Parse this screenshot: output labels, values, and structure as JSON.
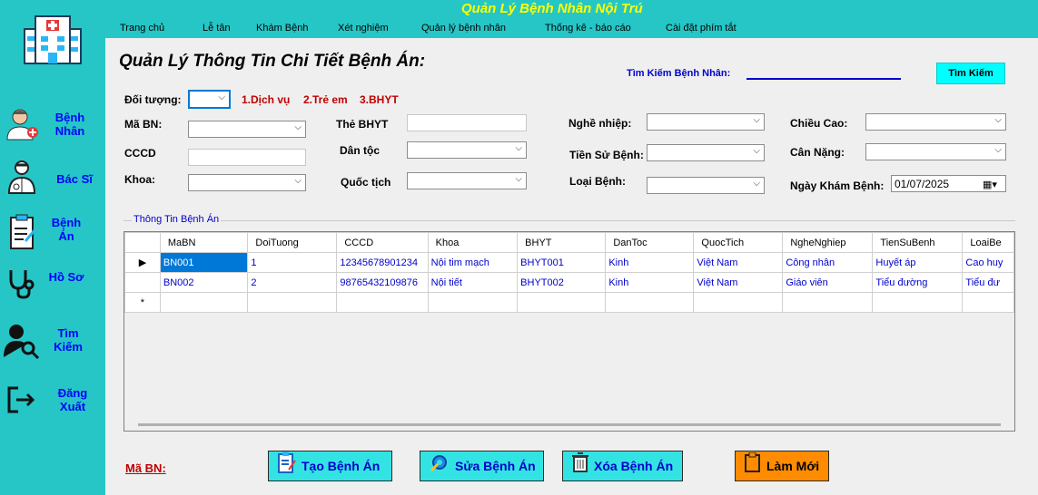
{
  "app": {
    "title": "Quản Lý Bệnh Nhân Nội Trú"
  },
  "menu": [
    "Trang chủ",
    "Lễ tân",
    "Khám Bệnh",
    "Xét nghiệm",
    "Quản lý bệnh nhân",
    "Thống kê - báo cáo",
    "Cài đặt phím tắt"
  ],
  "sidebar": {
    "logo_icon": "hospital-icon",
    "items": [
      {
        "label": "Bệnh Nhân",
        "icon": "patient-icon"
      },
      {
        "label": "Bác Sĩ",
        "icon": "doctor-icon"
      },
      {
        "label": "Bệnh Án",
        "icon": "clipboard-icon"
      },
      {
        "label": "Hồ Sơ",
        "icon": "stethoscope-icon"
      },
      {
        "label": "Tìm Kiếm",
        "icon": "search-user-icon"
      },
      {
        "label": "Đăng Xuất",
        "icon": "logout-icon"
      }
    ]
  },
  "page": {
    "title": "Quản Lý Thông Tin Chi Tiết Bệnh Án:"
  },
  "search": {
    "label": "Tìm Kiếm Bệnh Nhân:",
    "button": "Tìm Kiếm"
  },
  "form": {
    "doi_tuong_label": "Đối tượng:",
    "doi_tuong_options": [
      "1.Dịch vụ",
      "2.Trẻ em",
      "3.BHYT"
    ],
    "mabn_label": "Mã BN:",
    "cccd_label": "CCCD",
    "khoa_label": "Khoa:",
    "the_bhyt_label": "Thẻ BHYT",
    "dan_toc_label": "Dân tộc",
    "quoc_tich_label": "Quốc tịch",
    "nghe_nghiep_label": "Nghề nhiệp:",
    "tien_su_label": "Tiền Sử Bệnh:",
    "loai_benh_label": "Loại Bệnh:",
    "chieu_cao_label": "Chiều Cao:",
    "can_nang_label": "Cân Nặng:",
    "ngay_kham_label": "Ngày Khám Bệnh:",
    "ngay_kham_value": "01/07/2025"
  },
  "grid": {
    "group_label": "Thông Tin Bệnh Án",
    "columns": [
      "MaBN",
      "DoiTuong",
      "CCCD",
      "Khoa",
      "BHYT",
      "DanToc",
      "QuocTich",
      "NgheNghiep",
      "TienSuBenh",
      "LoaiBe"
    ],
    "rows": [
      [
        "BN001",
        "1",
        "12345678901234",
        "Nội tim mạch",
        "BHYT001",
        "Kinh",
        "Việt Nam",
        "Công nhân",
        "Huyết áp",
        "Cao huy"
      ],
      [
        "BN002",
        "2",
        "98765432109876",
        "Nội tiết",
        "BHYT002",
        "Kinh",
        "Việt Nam",
        "Giáo viên",
        "Tiểu đường",
        "Tiểu đư"
      ]
    ],
    "new_row_marker": "*",
    "current_row_marker": "▶"
  },
  "buttons": {
    "create": "Tạo Bệnh Án",
    "edit": "Sửa Bệnh Án",
    "delete": "Xóa Bệnh Án",
    "refresh": "Làm Mới"
  },
  "footer": {
    "mabn_label": "Mã BN:"
  },
  "colors": {
    "background": "#26c6c6",
    "content": "#efefef",
    "accent": "#0000cc",
    "title_yellow": "#ffff00",
    "selected": "#0078d7",
    "refresh": "#ff8c00"
  }
}
